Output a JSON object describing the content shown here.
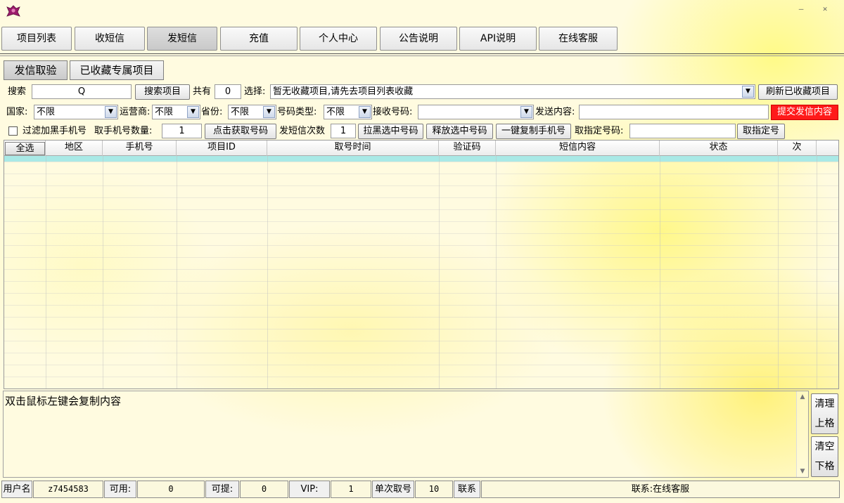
{
  "window": {
    "minimize_glyph": "—",
    "close_glyph": "✕"
  },
  "main_tabs": [
    "项目列表",
    "收短信",
    "发短信",
    "充值",
    "个人中心",
    "公告说明",
    "API说明",
    "在线客服"
  ],
  "sub_tabs": [
    "发信取验",
    "已收藏专属项目"
  ],
  "search_row": {
    "search_label": "搜索",
    "search_value": "Q",
    "search_button": "搜索项目",
    "total_prefix": "共有",
    "total_value": "0",
    "select_label": "选择:",
    "select_value": "暂无收藏项目,请先去项目列表收藏",
    "refresh_button": "刷新已收藏项目"
  },
  "filter_row": {
    "country_label": "国家:",
    "country_value": "不限",
    "carrier_label": "运营商:",
    "carrier_value": "不限",
    "province_label": "省份:",
    "province_value": "不限",
    "number_type_label": "号码类型:",
    "number_type_value": "不限",
    "receive_label": "接收号码:",
    "receive_value": "",
    "content_label": "发送内容:",
    "content_value": "",
    "submit_button": "提交发信内容"
  },
  "action_row": {
    "filter_blacklist": "过滤加黑手机号",
    "count_label": "取手机号数量:",
    "count_value": "1",
    "get_button": "点击获取号码",
    "send_times_label": "发短信次数",
    "send_times_value": "1",
    "blacklist_button": "拉黑选中号码",
    "release_button": "释放选中号码",
    "copy_button": "一键复制手机号",
    "specific_label": "取指定号码:",
    "specific_value": "",
    "specific_button": "取指定号"
  },
  "grid": {
    "select_all": "全选",
    "columns": [
      "地区",
      "手机号",
      "项目ID",
      "取号时间",
      "验证码",
      "短信内容",
      "状态",
      "次"
    ]
  },
  "log": {
    "text": "双击鼠标左键会复制内容",
    "clear_up_line1": "清理",
    "clear_up_line2": "上格",
    "clear_down_line1": "清空",
    "clear_down_line2": "下格"
  },
  "status_bar": {
    "user_label": "用户名",
    "user_value": "z7454583",
    "available_label": "可用:",
    "available_value": "0",
    "withdraw_label": "可提:",
    "withdraw_value": "0",
    "vip_label": "VIP:",
    "vip_value": "1",
    "single_label": "单次取号",
    "single_value": "10",
    "contact_label": "联系",
    "contact_value": "联系:在线客服"
  },
  "colors": {
    "accent_band": "#a9e9e6",
    "submit_red": "#ff1a1a",
    "background_yellow": "#fffbe0"
  }
}
